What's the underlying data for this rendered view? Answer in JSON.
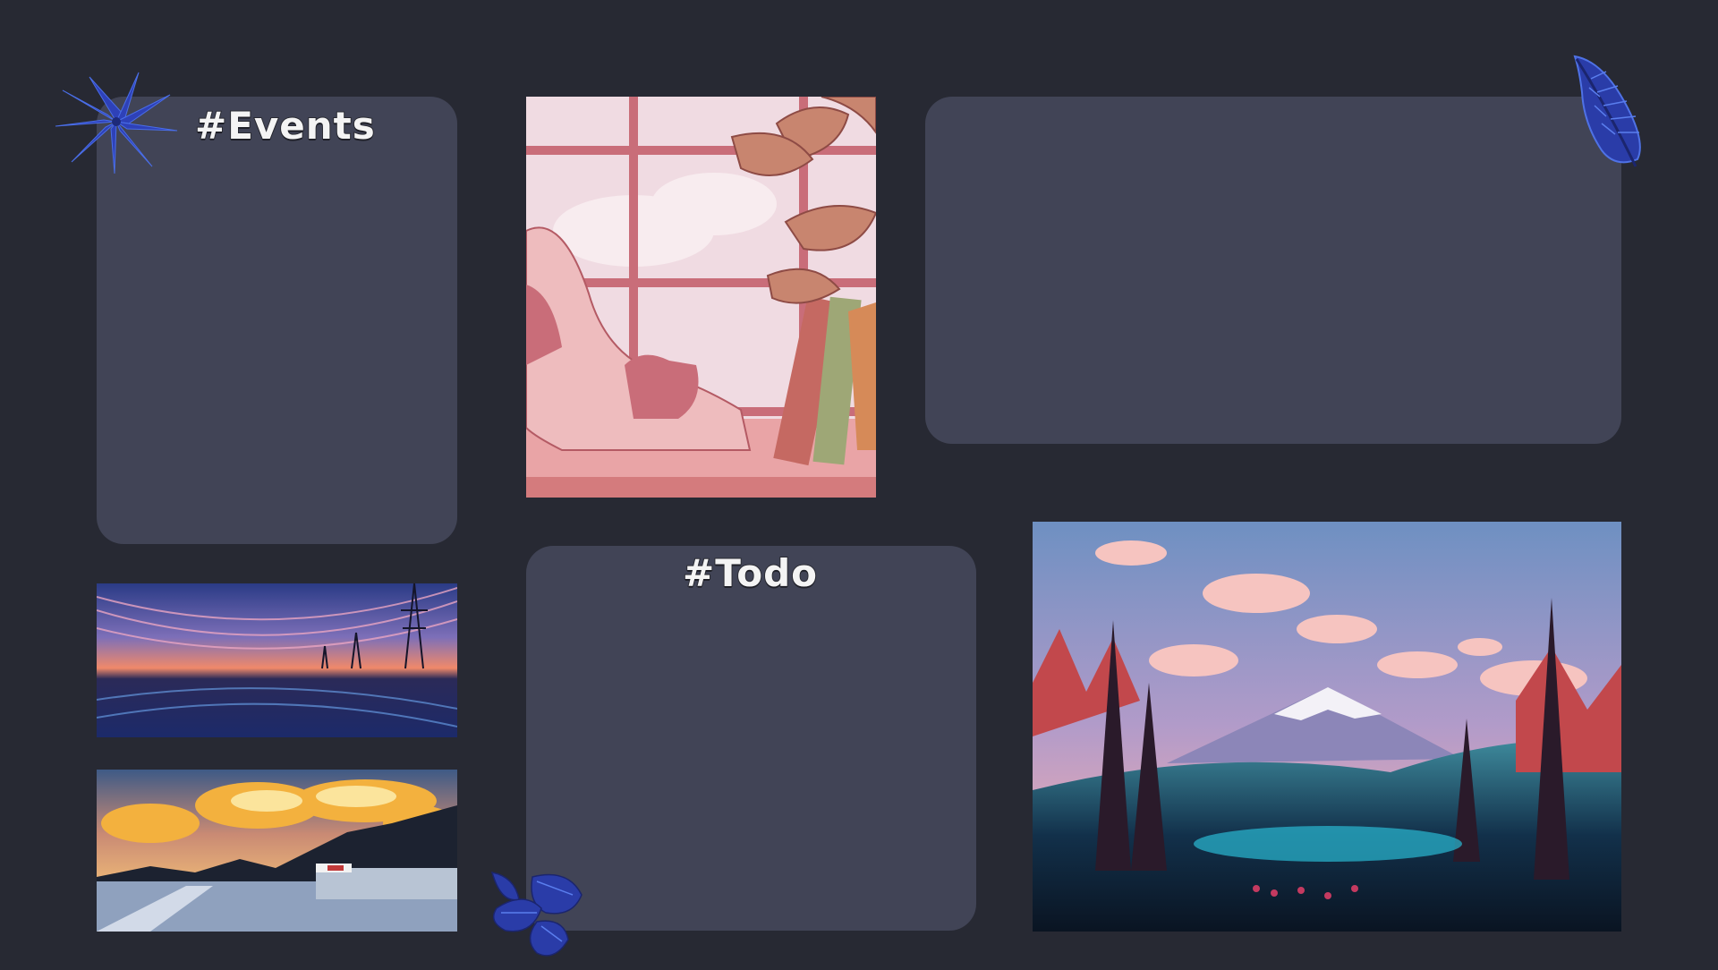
{
  "events_widget": {
    "title": "#Events"
  },
  "todo_widget": {
    "title": "#Todo"
  },
  "images": {
    "cat_window": "cat-window-illustration",
    "sky_reflection": "sunset-sky-reflection",
    "cafe_road": "cafe-road-sunset",
    "mountain_lake": "mountain-lake-landscape"
  },
  "decorations": {
    "top_left_leaf": "palm-leaf-icon",
    "top_right_leaf": "feather-leaf-icon",
    "bottom_leaf": "monstera-leaf-icon"
  },
  "colors": {
    "background": "#272933",
    "panel": "#414456",
    "title_text": "#f4f4f4",
    "leaf": "#2d3fb4"
  }
}
